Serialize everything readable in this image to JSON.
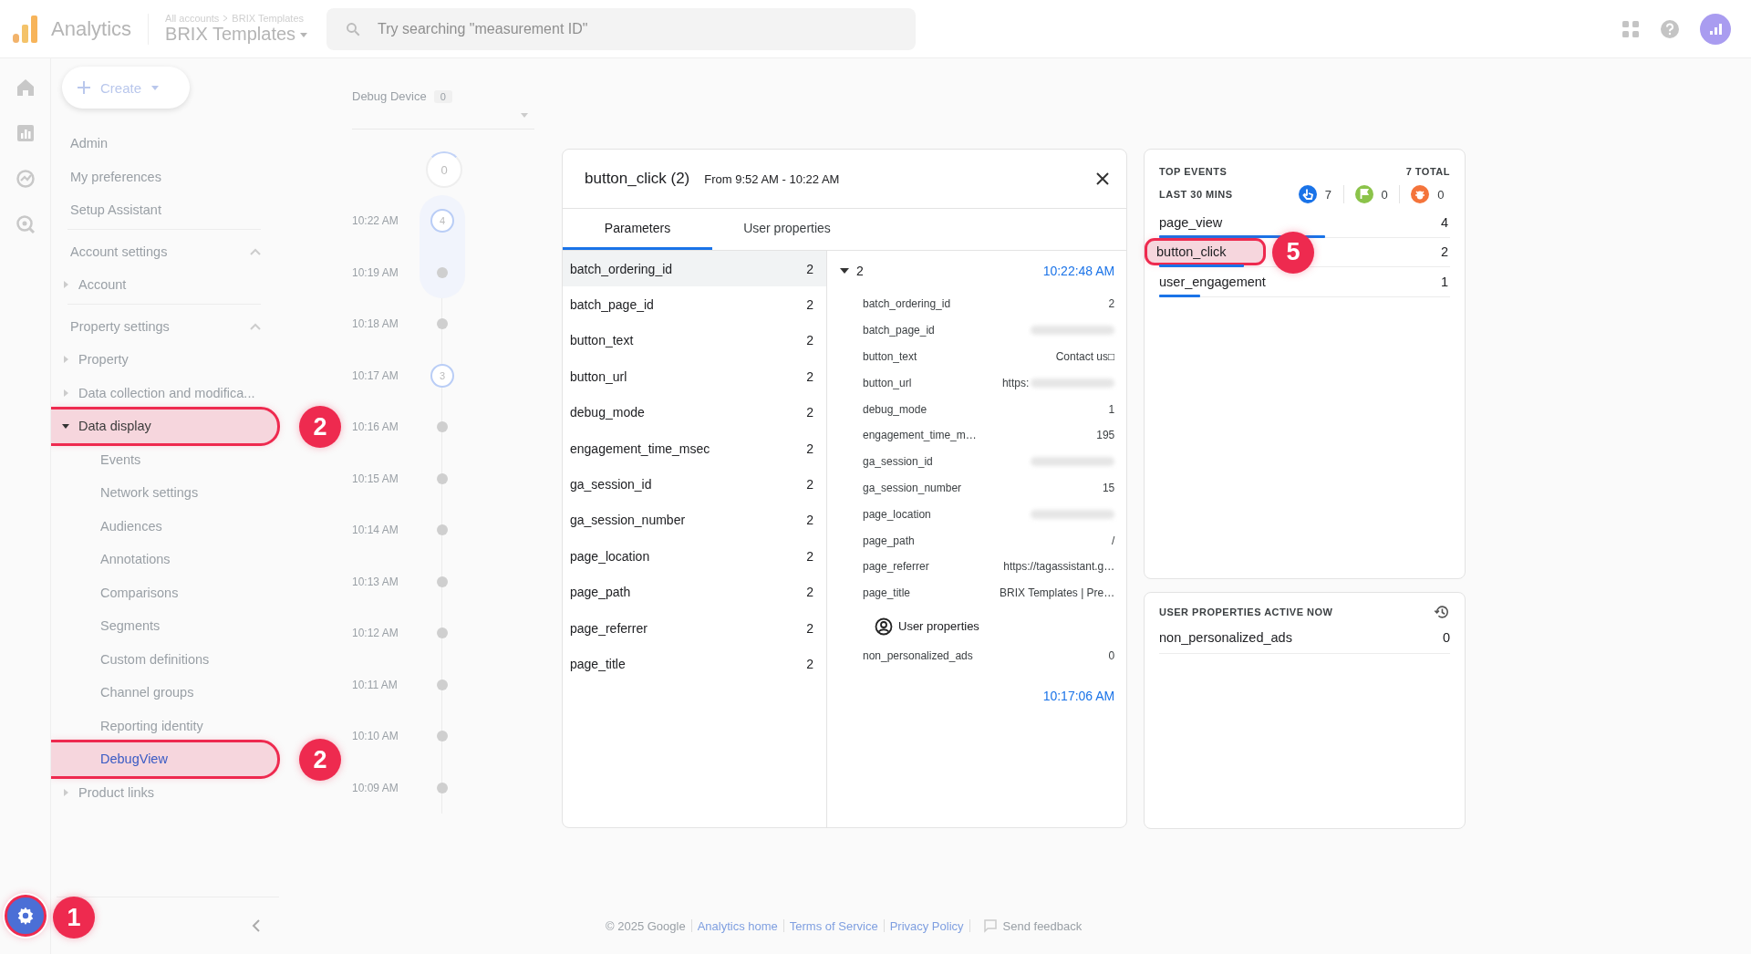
{
  "topbar": {
    "product": "Analytics",
    "breadcrumb": [
      "All accounts",
      "BRIX Templates"
    ],
    "property": "BRIX Templates",
    "search": {
      "placeholder": "Try searching \"measurement ID\""
    }
  },
  "rail": [
    {
      "kind": "home"
    },
    {
      "kind": "reports"
    },
    {
      "kind": "explore"
    },
    {
      "kind": "advertising"
    }
  ],
  "settings_button": {
    "badge": "1"
  },
  "create_button": "Create",
  "sidebar": {
    "items": [
      {
        "kind": "link",
        "label": "Admin"
      },
      {
        "kind": "link",
        "label": "My preferences"
      },
      {
        "kind": "link",
        "label": "Setup Assistant"
      },
      {
        "kind": "section",
        "label": "Account settings",
        "expanded": true,
        "children": [
          {
            "kind": "group",
            "label": "Account",
            "expanded": false
          }
        ]
      },
      {
        "kind": "section",
        "label": "Property settings",
        "expanded": true,
        "children": [
          {
            "kind": "group",
            "label": "Property",
            "expanded": false
          },
          {
            "kind": "group",
            "label": "Data collection and modifica...",
            "expanded": false
          },
          {
            "kind": "group",
            "label": "Data display",
            "expanded": true,
            "badge": "2",
            "children": [
              {
                "kind": "page",
                "label": "Events",
                "selected": false
              },
              {
                "kind": "page",
                "label": "Network settings",
                "selected": false
              },
              {
                "kind": "page",
                "label": "Audiences",
                "selected": false
              },
              {
                "kind": "page",
                "label": "Annotations",
                "selected": false
              },
              {
                "kind": "page",
                "label": "Comparisons",
                "selected": false
              },
              {
                "kind": "page",
                "label": "Segments",
                "selected": false
              },
              {
                "kind": "page",
                "label": "Custom definitions",
                "selected": false
              },
              {
                "kind": "page",
                "label": "Channel groups",
                "selected": false
              },
              {
                "kind": "page",
                "label": "Reporting identity",
                "selected": false
              },
              {
                "kind": "page",
                "label": "DebugView",
                "selected": true,
                "badge": "2"
              }
            ]
          },
          {
            "kind": "group",
            "label": "Product links",
            "expanded": false
          }
        ]
      }
    ]
  },
  "debug_device": {
    "label": "Debug Device",
    "count": "0"
  },
  "timeline": {
    "top_count": "0",
    "rows": [
      {
        "time": "10:22 AM",
        "kind": "events",
        "count": "4",
        "selected": true
      },
      {
        "time": "10:19 AM",
        "kind": "dot",
        "selected": true
      },
      {
        "time": "10:18 AM",
        "kind": "dot",
        "selected": false
      },
      {
        "time": "10:17 AM",
        "kind": "events",
        "count": "3",
        "selected": false
      },
      {
        "time": "10:16 AM",
        "kind": "dot",
        "selected": false
      },
      {
        "time": "10:15 AM",
        "kind": "dot",
        "selected": false
      },
      {
        "time": "10:14 AM",
        "kind": "dot",
        "selected": false
      },
      {
        "time": "10:13 AM",
        "kind": "dot",
        "selected": false
      },
      {
        "time": "10:12 AM",
        "kind": "dot",
        "selected": false
      },
      {
        "time": "10:11 AM",
        "kind": "dot",
        "selected": false
      },
      {
        "time": "10:10 AM",
        "kind": "dot",
        "selected": false
      },
      {
        "time": "10:09 AM",
        "kind": "dot",
        "selected": false
      }
    ]
  },
  "event_panel": {
    "title": "button_click (2)",
    "range": "From 9:52 AM - 10:22 AM",
    "tabs": [
      {
        "label": "Parameters",
        "selected": true
      },
      {
        "label": "User properties",
        "selected": false
      }
    ],
    "parameters": [
      {
        "name": "batch_ordering_id",
        "count": "2",
        "selected": true
      },
      {
        "name": "batch_page_id",
        "count": "2",
        "selected": false
      },
      {
        "name": "button_text",
        "count": "2",
        "selected": false
      },
      {
        "name": "button_url",
        "count": "2",
        "selected": false
      },
      {
        "name": "debug_mode",
        "count": "2",
        "selected": false
      },
      {
        "name": "engagement_time_msec",
        "count": "2",
        "selected": false
      },
      {
        "name": "ga_session_id",
        "count": "2",
        "selected": false
      },
      {
        "name": "ga_session_number",
        "count": "2",
        "selected": false
      },
      {
        "name": "page_location",
        "count": "2",
        "selected": false
      },
      {
        "name": "page_path",
        "count": "2",
        "selected": false
      },
      {
        "name": "page_referrer",
        "count": "2",
        "selected": false
      },
      {
        "name": "page_title",
        "count": "2",
        "selected": false
      }
    ],
    "detail": {
      "count": "2",
      "expanded": true,
      "time": "10:22:48 AM",
      "params": [
        {
          "name": "batch_ordering_id",
          "value": "2"
        },
        {
          "name": "batch_page_id",
          "redacted": true
        },
        {
          "name": "button_text",
          "value": "Contact us□"
        },
        {
          "name": "button_url",
          "value": "https:",
          "redacted": true
        },
        {
          "name": "debug_mode",
          "value": "1"
        },
        {
          "name": "engagement_time_m…",
          "value": "195"
        },
        {
          "name": "ga_session_id",
          "redacted": true
        },
        {
          "name": "ga_session_number",
          "value": "15"
        },
        {
          "name": "page_location",
          "redacted": true
        },
        {
          "name": "page_path",
          "value": "/"
        },
        {
          "name": "page_referrer",
          "value": "https://tagassistant.g…"
        },
        {
          "name": "page_title",
          "value": "BRIX Templates | Pre…"
        }
      ],
      "user_properties_heading": "User properties",
      "user_properties": [
        {
          "name": "non_personalized_ads",
          "value": "0"
        }
      ],
      "next_time": "10:17:06 AM"
    }
  },
  "top_events": {
    "title": "TOP EVENTS",
    "total": "7 TOTAL",
    "period": "LAST 30 MINS",
    "counters": [
      {
        "kind": "event",
        "count": "7"
      },
      {
        "kind": "conversion",
        "count": "0"
      },
      {
        "kind": "error",
        "count": "0"
      }
    ],
    "events": [
      {
        "name": "page_view",
        "count": "4",
        "level": 0.57
      },
      {
        "name": "button_click",
        "count": "2",
        "level": 0.29,
        "badge": "5"
      },
      {
        "name": "user_engagement",
        "count": "1",
        "level": 0.14
      }
    ]
  },
  "user_properties_card": {
    "title": "USER PROPERTIES ACTIVE NOW",
    "rows": [
      {
        "name": "non_personalized_ads",
        "value": "0"
      }
    ]
  },
  "footer": {
    "copyright": "© 2025 Google",
    "links": [
      "Analytics home",
      "Terms of Service",
      "Privacy Policy"
    ],
    "feedback": "Send feedback"
  }
}
